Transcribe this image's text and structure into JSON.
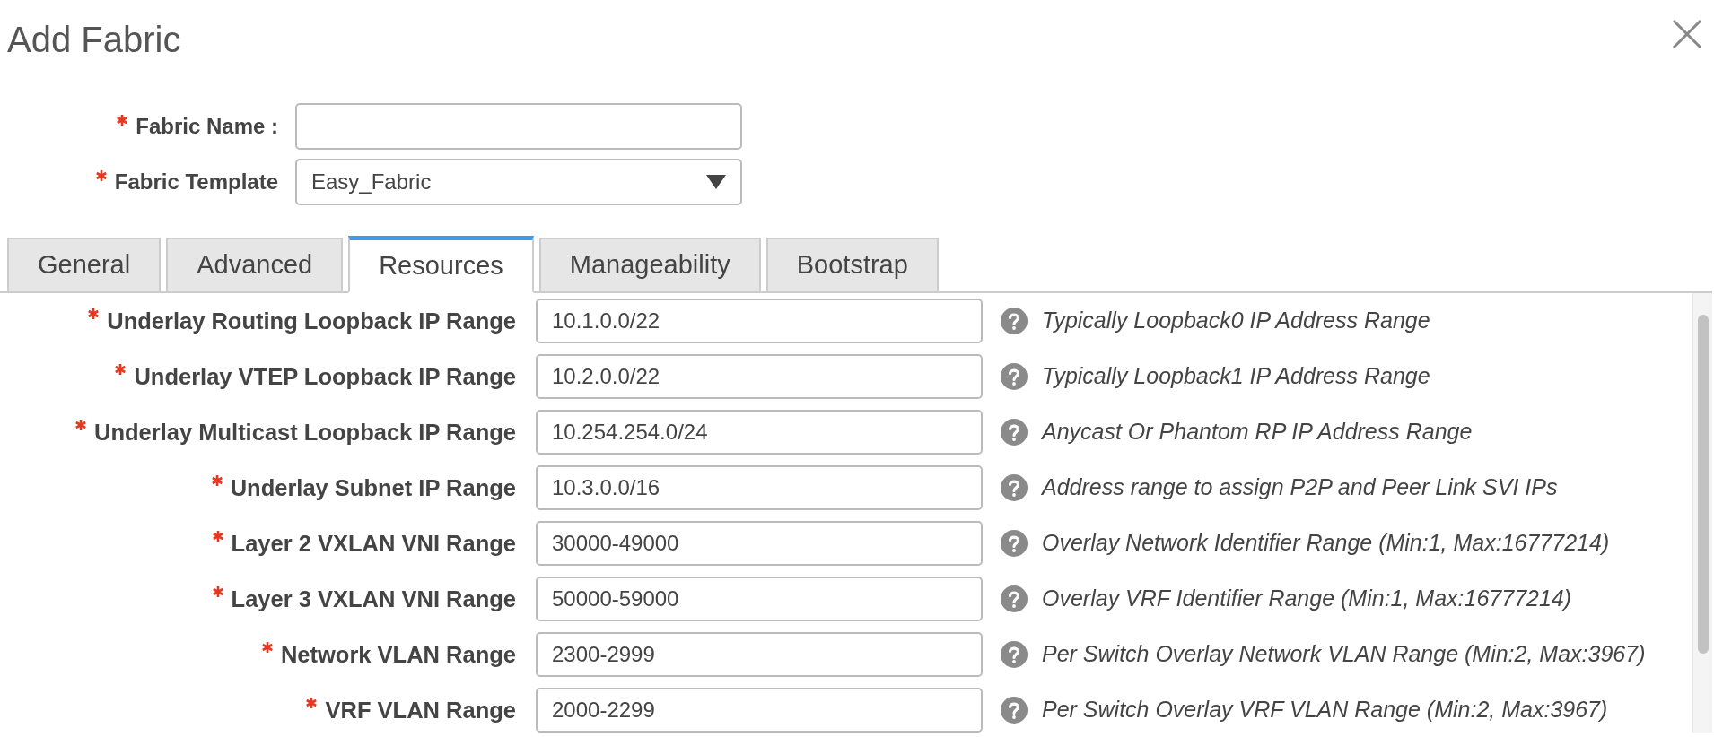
{
  "dialog": {
    "title": "Add Fabric"
  },
  "header_fields": [
    {
      "kind": "text",
      "label": "Fabric Name :",
      "required": true
    },
    {
      "kind": "select",
      "label": "Fabric Template",
      "required": true,
      "value": "Easy_Fabric"
    }
  ],
  "tabs": [
    {
      "label": "General",
      "selected": false
    },
    {
      "label": "Advanced",
      "selected": false
    },
    {
      "label": "Resources",
      "selected": true
    },
    {
      "label": "Manageability",
      "selected": false
    },
    {
      "label": "Bootstrap",
      "selected": false
    }
  ],
  "fields": [
    {
      "label": "Underlay Routing Loopback IP Range",
      "required": true,
      "value": "10.1.0.0/22",
      "help": "Typically Loopback0 IP Address Range"
    },
    {
      "label": "Underlay VTEP Loopback IP Range",
      "required": true,
      "value": "10.2.0.0/22",
      "help": "Typically Loopback1 IP Address Range"
    },
    {
      "label": "Underlay Multicast Loopback IP Range",
      "required": true,
      "value": "10.254.254.0/24",
      "help": "Anycast Or Phantom RP IP Address Range"
    },
    {
      "label": "Underlay Subnet IP Range",
      "required": true,
      "value": "10.3.0.0/16",
      "help": "Address range to assign P2P and Peer Link SVI IPs"
    },
    {
      "label": "Layer 2 VXLAN VNI Range",
      "required": true,
      "value": "30000-49000",
      "help": "Overlay Network Identifier Range (Min:1, Max:16777214)"
    },
    {
      "label": "Layer 3 VXLAN VNI Range",
      "required": true,
      "value": "50000-59000",
      "help": "Overlay VRF Identifier Range (Min:1, Max:16777214)"
    },
    {
      "label": "Network VLAN Range",
      "required": true,
      "value": "2300-2999",
      "help": "Per Switch Overlay Network VLAN Range (Min:2, Max:3967)"
    },
    {
      "label": "VRF VLAN Range",
      "required": true,
      "value": "2000-2299",
      "help": "Per Switch Overlay VRF VLAN Range (Min:2, Max:3967)"
    }
  ]
}
